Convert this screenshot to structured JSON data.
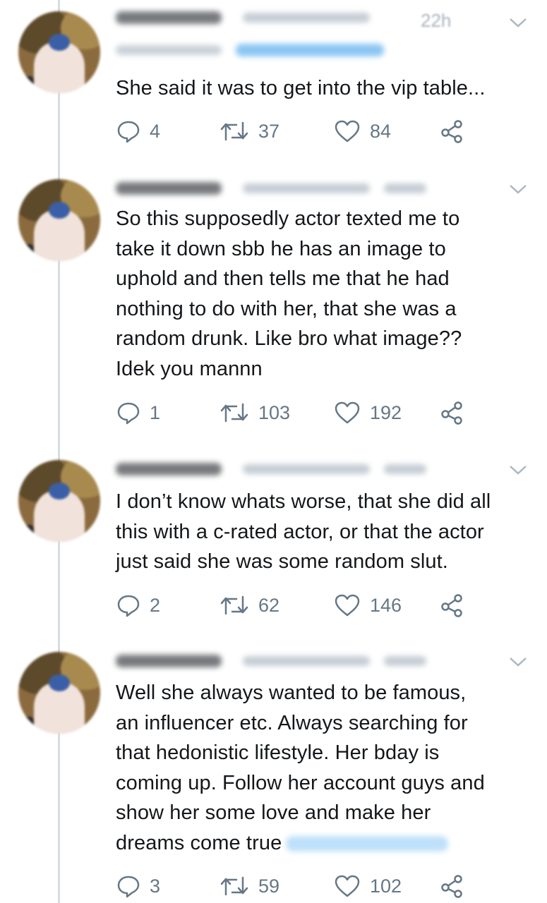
{
  "tweets": [
    {
      "time": "22h",
      "text": "She said it was to get into the vip table...",
      "replies": "4",
      "retweets": "37",
      "likes": "84",
      "has_reply_line": true,
      "has_mention": false
    },
    {
      "time": "",
      "text": "So this supposedly actor texted me to\ntake it down sbb he has an image to\nuphold and then tells me that he had\nnothing to do with her, that she was a\nrandom drunk. Like bro what image??\nIdek you mannn",
      "replies": "1",
      "retweets": "103",
      "likes": "192",
      "has_reply_line": false,
      "has_mention": false
    },
    {
      "time": "",
      "text": "I don’t know whats worse, that she did all\nthis with a c-rated actor, or that the actor\njust said she was some random slut.",
      "replies": "2",
      "retweets": "62",
      "likes": "146",
      "has_reply_line": false,
      "has_mention": false
    },
    {
      "time": "",
      "text": "Well she always wanted to be famous,\nan influencer etc. Always searching for\nthat hedonistic lifestyle. Her bday is\ncoming up. Follow her account guys and\nshow her some love and make her\ndreams come true",
      "replies": "3",
      "retweets": "59",
      "likes": "102",
      "has_reply_line": false,
      "has_mention": true
    }
  ],
  "icons": {
    "reply": "reply-icon",
    "retweet": "retweet-icon",
    "like": "heart-icon",
    "share": "share-icon",
    "more": "chevron-down-icon"
  },
  "colors": {
    "text": "#14171a",
    "muted": "#657786",
    "thread_line": "#d6dde3",
    "mention": "#1da1f2"
  }
}
